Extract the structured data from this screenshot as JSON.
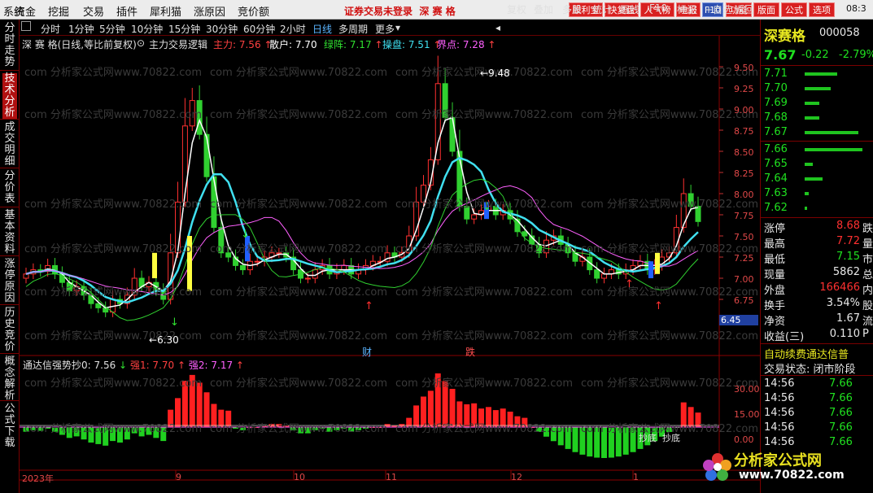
{
  "topbar": {
    "menus": [
      "系统",
      "资金",
      "挖掘",
      "交易",
      "插件",
      "犀利猫",
      "涨原因",
      "竞价额"
    ],
    "status": "证券交易未登录",
    "stock_title": "深 赛 格",
    "buttons": [
      "犀利宝",
      "快复盘",
      "人气榜",
      "电报",
      "F10",
      "功能",
      "版面",
      "公式",
      "选项"
    ],
    "clock": "08:3"
  },
  "sidebar": {
    "tabs": [
      "分时走势",
      "技术分析",
      "成交明细",
      "分价表",
      "基本资料",
      "涨停原因",
      "历史竞价",
      "概念解析",
      "公式下载"
    ]
  },
  "periods": [
    "分时",
    "1分钟",
    "5分钟",
    "10分钟",
    "15分钟",
    "30分钟",
    "60分钟",
    "2小时",
    "日线",
    "多周期",
    "更多"
  ],
  "selected_period": "日线",
  "tools": [
    "复权",
    "叠加",
    "多股",
    "统计",
    "画线",
    "F10",
    "标记",
    "+自选",
    "返回"
  ],
  "main_chart": {
    "title": "深 赛 格(日线,等比前复权)",
    "formula": "主力交易逻辑",
    "ind_labels": [
      {
        "t": "主力: 7.56",
        "c": "#ff4040"
      },
      {
        "t": "散户: 7.70",
        "c": "#ffffff"
      },
      {
        "t": "绿阵: 7.17",
        "c": "#30e030"
      },
      {
        "t": "操盘: 7.51",
        "c": "#40e0f0"
      },
      {
        "t": "界点: 7.28",
        "c": "#ff60ff"
      }
    ],
    "high_label": "9.48",
    "low_label": "6.30",
    "marker1": "财",
    "marker2": "跌",
    "y_ticks": [
      "9.50",
      "9.25",
      "9.00",
      "8.75",
      "8.50",
      "8.25",
      "8.00",
      "7.75",
      "7.50",
      "7.25",
      "7.00",
      "6.75"
    ],
    "cursor_price": "6.45"
  },
  "sub_chart": {
    "title": "通达信强势抄0",
    "value": ": 7.56",
    "labels": [
      {
        "t": "强1: 7.70",
        "c": "#ff4040"
      },
      {
        "t": "强2: 7.17",
        "c": "#ff60ff"
      }
    ],
    "y_ticks": [
      "30.00",
      "15.00",
      "0.00"
    ],
    "tag1": "抄底",
    "tag2": "抄底"
  },
  "x_axis": [
    "2023年",
    "9",
    "10",
    "11",
    "12",
    "1"
  ],
  "watermark": "com 分析家公式网www.70822.com",
  "quote": {
    "name": "深赛格",
    "code": "000058",
    "price": "7.67",
    "change": "-0.22",
    "pct": "-2.79%",
    "asks": [
      [
        "7.71",
        40
      ],
      [
        "7.70",
        32
      ],
      [
        "7.69",
        18
      ],
      [
        "7.68",
        18
      ],
      [
        "7.67",
        66
      ]
    ],
    "bids": [
      [
        "7.66",
        71
      ],
      [
        "7.65",
        10
      ],
      [
        "7.64",
        22
      ],
      [
        "7.63",
        5
      ],
      [
        "7.62",
        3
      ]
    ],
    "stats": [
      [
        "涨停",
        "8.68",
        "跌"
      ],
      [
        "最高",
        "7.72",
        "量"
      ],
      [
        "最低",
        "7.15",
        "市"
      ],
      [
        "现量",
        "5862",
        "总"
      ],
      [
        "外盘",
        "166466",
        "内"
      ],
      [
        "换手",
        "3.54%",
        "股"
      ],
      [
        "净资",
        "1.67",
        "流"
      ],
      [
        "收益(三)",
        "0.110",
        "P"
      ]
    ],
    "ad": "自动续费通达信普",
    "state": "交易状态: 闭市阶段",
    "trades": [
      [
        "14:56",
        "7.66"
      ],
      [
        "14:56",
        "7.66"
      ],
      [
        "14:56",
        "7.66"
      ],
      [
        "14:56",
        "7.66"
      ],
      [
        "14:56",
        "7.66"
      ]
    ]
  },
  "logo": {
    "name": "分析家公式网",
    "url": "www.70822.com"
  },
  "chart_data": {
    "type": "candlestick",
    "ylim": [
      6.7,
      9.55
    ],
    "closes": [
      7.05,
      7.1,
      7.08,
      7.15,
      7.05,
      6.95,
      6.85,
      6.9,
      6.8,
      6.7,
      6.65,
      6.6,
      6.75,
      6.7,
      6.8,
      7.0,
      6.9,
      6.95,
      6.85,
      6.75,
      7.3,
      7.9,
      8.8,
      9.1,
      8.7,
      8.2,
      7.6,
      7.3,
      7.25,
      7.15,
      7.1,
      7.2,
      7.2,
      7.25,
      7.3,
      7.3,
      7.25,
      7.1,
      7.0,
      7.0,
      7.1,
      7.15,
      7.05,
      7.1,
      7.15,
      7.05,
      7.1,
      7.15,
      7.2,
      7.2,
      7.3,
      7.25,
      7.3,
      7.5,
      7.9,
      8.1,
      8.4,
      9.3,
      8.9,
      8.5,
      7.85,
      7.7,
      7.75,
      7.8,
      7.85,
      7.75,
      7.8,
      7.7,
      7.55,
      7.5,
      7.4,
      7.3,
      7.45,
      7.5,
      7.4,
      7.3,
      7.2,
      7.25,
      7.1,
      7.0,
      7.05,
      7.1,
      7.05,
      7.1,
      7.15,
      7.2,
      7.1,
      7.15,
      7.25,
      7.3,
      7.6,
      8.0,
      7.85,
      7.67
    ]
  }
}
